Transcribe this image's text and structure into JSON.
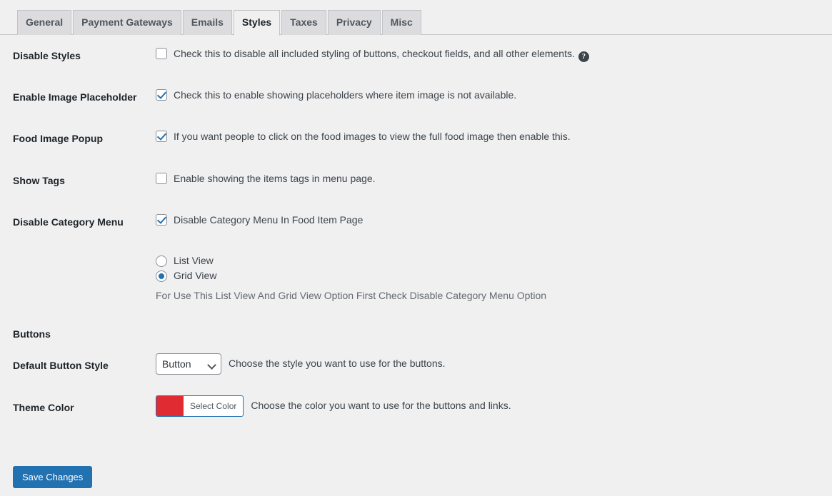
{
  "tabs": [
    {
      "label": "General",
      "active": false
    },
    {
      "label": "Payment Gateways",
      "active": false
    },
    {
      "label": "Emails",
      "active": false
    },
    {
      "label": "Styles",
      "active": true
    },
    {
      "label": "Taxes",
      "active": false
    },
    {
      "label": "Privacy",
      "active": false
    },
    {
      "label": "Misc",
      "active": false
    }
  ],
  "settings": {
    "disable_styles": {
      "label": "Disable Styles",
      "description": "Check this to disable all included styling of buttons, checkout fields, and all other elements.",
      "checked": false,
      "help_icon": "help-icon",
      "help_glyph": "?"
    },
    "enable_image_placeholder": {
      "label": "Enable Image Placeholder",
      "description": "Check this to enable showing placeholders where item image is not available.",
      "checked": true
    },
    "food_image_popup": {
      "label": "Food Image Popup",
      "description": "If you want people to click on the food images to view the full food image then enable this.",
      "checked": true
    },
    "show_tags": {
      "label": "Show Tags",
      "description": "Enable showing the items tags in menu page.",
      "checked": false
    },
    "disable_category_menu": {
      "label": "Disable Category Menu",
      "description": "Disable Category Menu In Food Item Page",
      "checked": true,
      "view_options": [
        {
          "label": "List View",
          "selected": false
        },
        {
          "label": "Grid View",
          "selected": true
        }
      ],
      "hint": "For Use This List View And Grid View Option First Check Disable Category Menu Option"
    },
    "buttons_section": {
      "label": "Buttons"
    },
    "default_button_style": {
      "label": "Default Button Style",
      "value": "Button",
      "options": [
        "Button"
      ],
      "description": "Choose the style you want to use for the buttons.",
      "chevron_icon": "chevron-down-icon"
    },
    "theme_color": {
      "label": "Theme Color",
      "swatch_color": "#e02b32",
      "button_label": "Select Color",
      "description": "Choose the color you want to use for the buttons and links."
    }
  },
  "submit": {
    "save_label": "Save Changes"
  }
}
